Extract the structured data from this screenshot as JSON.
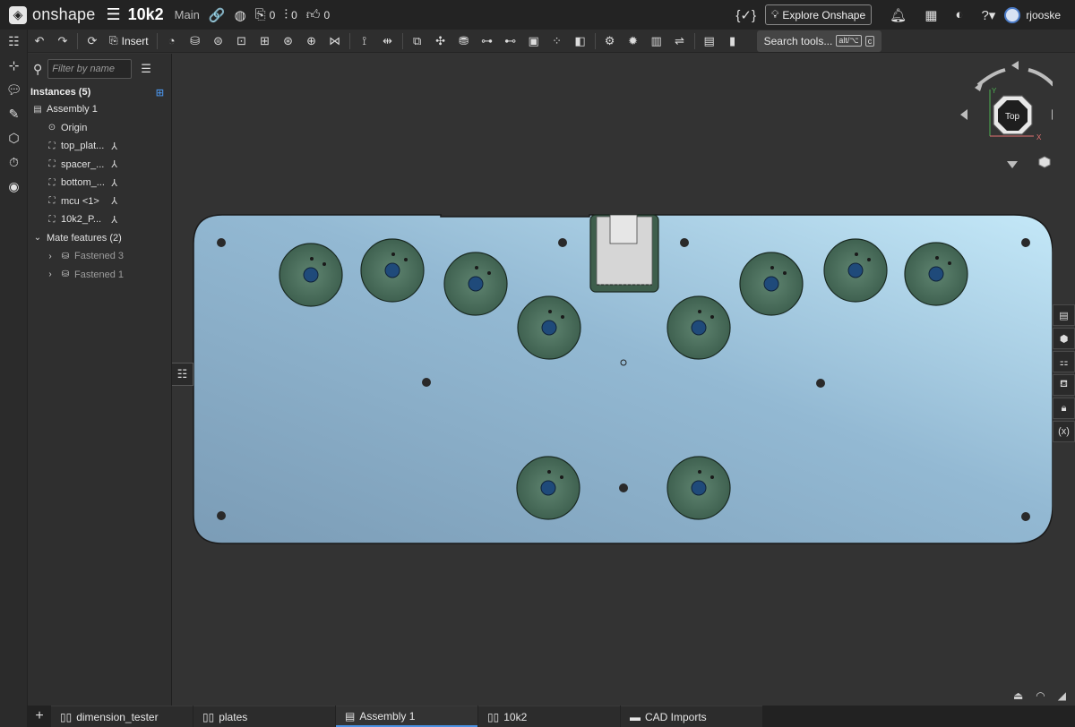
{
  "header": {
    "app_name": "onshape",
    "doc_title": "10k2",
    "branch": "Main",
    "versions_count": "0",
    "links_count": "0",
    "likes_count": "0",
    "explore_label": "Explore Onshape",
    "username": "rjooske"
  },
  "toolbar": {
    "insert_label": "Insert",
    "search_label": "Search tools...",
    "search_shortcut_1": "alt/⌥",
    "search_shortcut_2": "c"
  },
  "panel": {
    "filter_placeholder": "Filter by name",
    "instances_header": "Instances (5)",
    "assembly": "Assembly 1",
    "origin": "Origin",
    "instances": [
      {
        "label": "top_plat..."
      },
      {
        "label": "spacer_..."
      },
      {
        "label": "bottom_..."
      },
      {
        "label": "mcu <1>"
      },
      {
        "label": "10k2_P..."
      }
    ],
    "mate_header": "Mate features (2)",
    "mates": [
      {
        "label": "Fastened 3"
      },
      {
        "label": "Fastened 1"
      }
    ]
  },
  "viewcube": {
    "face_label": "Top",
    "axis_x": "X",
    "axis_y": "Y"
  },
  "tabs": [
    {
      "label": "dimension_tester"
    },
    {
      "label": "plates"
    },
    {
      "label": "Assembly 1"
    },
    {
      "label": "10k2"
    },
    {
      "label": "CAD Imports"
    }
  ],
  "colors": {
    "plate_light": "#bfe3f5",
    "plate_dark": "#7fa2bd",
    "button_green": "#4a6e5a",
    "button_core": "#1f4a7a",
    "active_tab_accent": "#4a90e2"
  }
}
